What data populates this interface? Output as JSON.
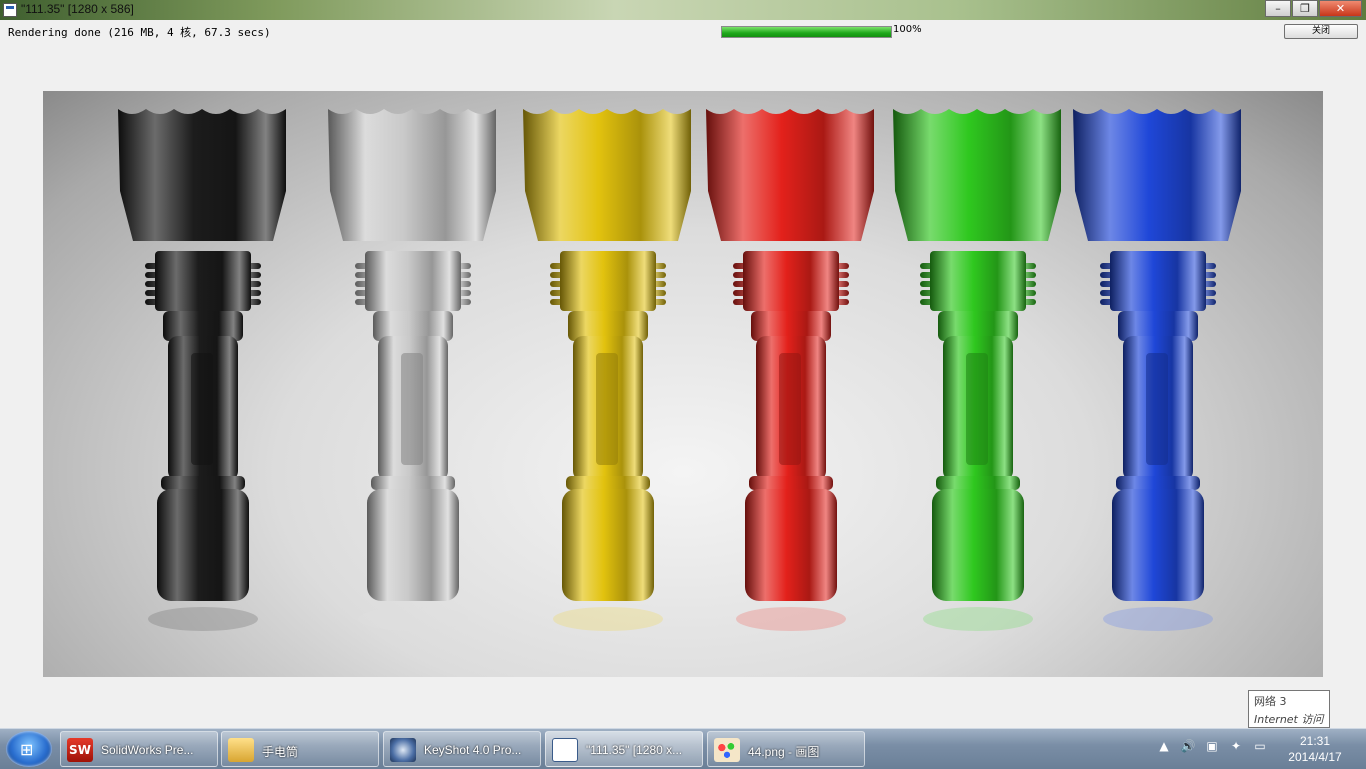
{
  "window": {
    "title": "\"111.35\" [1280 x 586]",
    "controls": {
      "minimize": "–",
      "maximize": "❐",
      "close": "✕"
    }
  },
  "status": {
    "text": "Rendering done (216 MB, 4 核, 67.3 secs)",
    "progress_percent": 100,
    "progress_label": "100%",
    "close_button": "关闭"
  },
  "render": {
    "flashlight_colors": [
      "#1c1c1c",
      "#c9c9c9",
      "#e2c20e",
      "#e3211b",
      "#2fc81f",
      "#1f47d8"
    ]
  },
  "tooltip": {
    "line1": "网络  3",
    "line2": "Internet 访问"
  },
  "taskbar": {
    "start_icon": "windows-logo-icon",
    "items": [
      {
        "label": "SolidWorks Pre...",
        "icon": "solidworks-icon",
        "icon_text": "SW"
      },
      {
        "label": "手电筒",
        "icon": "folder-icon"
      },
      {
        "label": "KeyShot 4.0 Pro...",
        "icon": "keyshot-icon"
      },
      {
        "label": "\"111.35\" [1280 x...",
        "icon": "render-window-icon"
      },
      {
        "label": "44.png - 画图",
        "icon": "paint-icon"
      }
    ],
    "tray_icons": {
      "show_hidden": "▲",
      "volume": "🔊",
      "device": "▣",
      "update": "✦",
      "network": "▭"
    },
    "clock": {
      "time": "21:31",
      "date": "2014/4/17"
    }
  }
}
